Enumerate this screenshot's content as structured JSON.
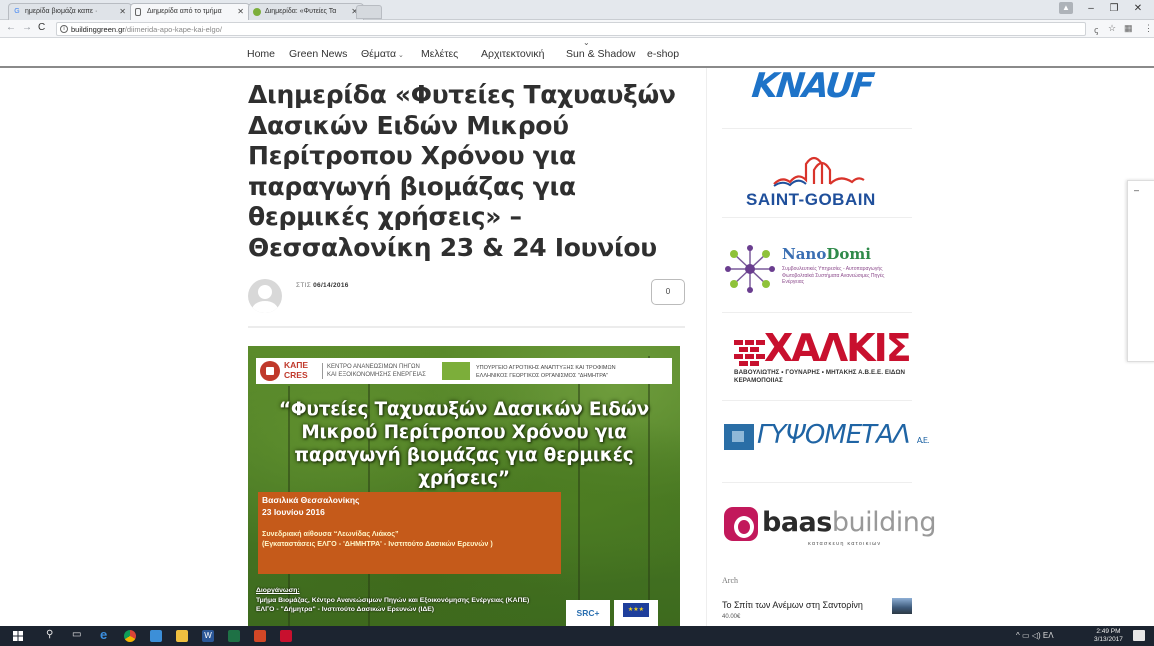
{
  "browser": {
    "tabs": [
      {
        "label": "ημερίδα βιομάζα καπε ·",
        "icon": "google-favicon",
        "active": false
      },
      {
        "label": "Διημερίδα από το τμήμα",
        "icon": "page-favicon",
        "active": true
      },
      {
        "label": "Διημερίδα: «Φυτείες Τα",
        "icon": "site-favicon",
        "active": false
      }
    ],
    "url_host": "buildinggreen.gr",
    "url_path": "/diimerida-apo-kape-kai-elgo/"
  },
  "site_nav": {
    "items": [
      "Home",
      "Green News",
      "Θέματα",
      "Μελέτες",
      "Αρχιτεκτονική",
      "Sun & Shadow",
      "e-shop"
    ]
  },
  "article": {
    "title": "Διημερίδα «Φυτείες Ταχυαυξών Δασικών Ειδών Μικρού Περίτροπου Χρόνου για παραγωγή βιομάζας για θερμικές χρήσεις» – Θεσσαλονίκη 23 & 24 Ιουνίου",
    "meta_prefix": "ΣΤΙΣ",
    "date": "06/14/2016",
    "comment_count": "0"
  },
  "poster": {
    "kape_abbr_1": "ΚΑΠΕ",
    "kape_abbr_2": "CRES",
    "kape_full_1": "ΚΕΝΤΡΟ ΑΝΑΝΕΩΣΙΜΩΝ ΠΗΓΩΝ",
    "kape_full_2": "ΚΑΙ ΕΞΟΙΚΟΝΟΜΗΣΗΣ ΕΝΕΡΓΕΙΑΣ",
    "ministry_1": "ΥΠΟΥΡΓΕΙΟ ΑΓΡΟΤΙΚΗΣ ΑΝΑΠΤΥΞΗΣ ΚΑΙ ΤΡΟΦΙΜΩΝ",
    "ministry_2": "ΕΛΛΗΝΙΚΟΣ ΓΕΩΡΓΙΚΟΣ ΟΡΓΑΝΙΣΜΟΣ \"ΔΗΜΗΤΡΑ\"",
    "title": "“Φυτείες Ταχυαυξών Δασικών Ειδών Μικρού Περίτροπου Χρόνου για παραγωγή βιομάζας για θερμικές χρήσεις”",
    "location": "Βασιλικά Θεσσαλονίκης",
    "date": "23 Ιουνίου 2016",
    "venue_1": "Συνεδριακή αίθουσα “Λεωνίδας Λιάκος”",
    "venue_2": "(Εγκαταστάσεις ΕΛΓΟ - 'ΔΗΜΗΤΡΑ' - Ινστιτούτο Δασικών Ερευνών )",
    "org_label": "Διοργάνωση:",
    "org_1": "Τμήμα Βιομάζας, Κέντρο Ανανεώσιμων Πηγών και Εξοικονόμησης Ενέργειας (ΚΑΠΕ)",
    "org_2": "ΕΛΓΟ - \"Δήμητρα\" - Ινστιτούτο Δασικών Ερευνών (ΙΔΕ)",
    "src_logo": "SRC+"
  },
  "sidebar": {
    "knauf": "KNAUF",
    "saint_gobain": "SAINT-GOBAIN",
    "nanodomi_1": "Nano",
    "nanodomi_2": "Domi",
    "nanodomi_sub": "Συμβουλευτικές Υπηρεσίες - Αυτοπαραγωγής Φωτοβολταϊκά Συστήματα Ανανεώσιμες Πηγές Ενέργειας",
    "xalkis": "ΧΑΛΚΙΣ",
    "xalkis_sub": "ΒΑΒΟΥΛΙΩΤΗΣ • ΓΟΥΝΑΡΗΣ • ΜΗΤΑΚΗΣ Α.Β.Ε.Ε. ΕΙΔΩΝ ΚΕΡΑΜΟΠΟΙΙΑΣ",
    "gypsometal": "ΓΥΨΟΜΕΤΑΛ",
    "gypsometal_suffix": "Α.Ε.",
    "baas_1": "baas",
    "baas_2": "building",
    "baas_sub": "κατασκευη κατοικιων",
    "arch_heading": "Arch",
    "arch_item": "Το Σπίτι των Ανέμων στη Σαντορίνη",
    "arch_price": "40.00€"
  },
  "taskbar": {
    "lang": "ΕΛ",
    "time": "2:49 PM",
    "date": "3/13/2017"
  },
  "colors": {
    "knauf": "#1e73c8",
    "saint_gobain": "#1f4f9b",
    "xalkis": "#c8102e",
    "baas": "#c2185b",
    "poster_box": "#c55a1a"
  }
}
